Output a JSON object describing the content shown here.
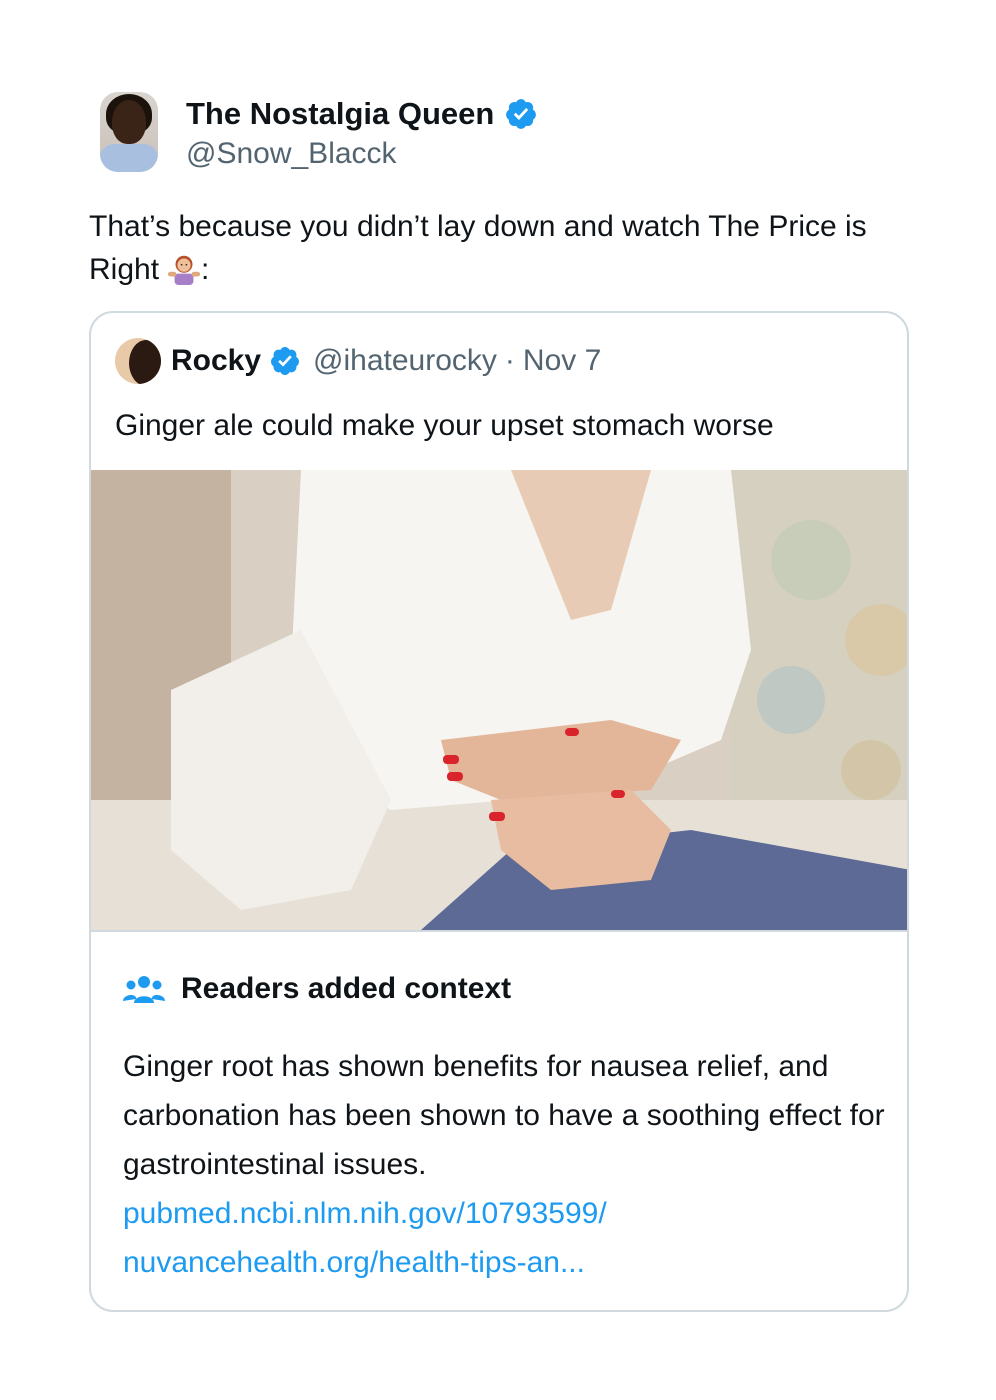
{
  "tweet": {
    "author": {
      "display_name": "The Nostalgia Queen",
      "handle": "@Snow_Blacck",
      "verified": true
    },
    "text": "That’s because you didn’t lay down and watch The Price is Right",
    "text_suffix": ":",
    "emoji": "person-shrugging-emoji"
  },
  "quote": {
    "author": {
      "display_name": "Rocky",
      "handle": "@ihateurocky",
      "verified": true
    },
    "separator": "·",
    "date": "Nov 7",
    "text": "Ginger ale could make your upset stomach worse",
    "image": "woman-holding-stomach-photo"
  },
  "context": {
    "icon": "people-icon",
    "title": "Readers added context",
    "body": "Ginger root has shown benefits for nausea relief, and carbonation has been shown to have a soothing effect for gastrointestinal issues.",
    "links": [
      "pubmed.ncbi.nlm.nih.gov/10793599/",
      "nuvancehealth.org/health-tips-an..."
    ]
  },
  "colors": {
    "verified_blue": "#1d9bf0",
    "link_blue": "#1d9bf0",
    "secondary_text": "#536471",
    "border": "#cfd9de"
  }
}
